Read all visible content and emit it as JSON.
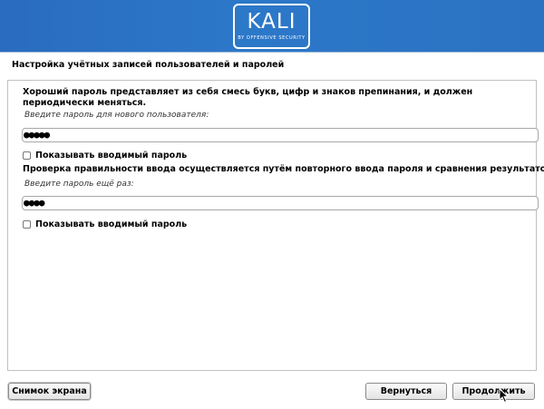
{
  "banner": {
    "logo_text": "KALI",
    "logo_subtitle": "BY OFFENSIVE SECURITY",
    "brand_color": "#2c75c6"
  },
  "page_title": "Настройка учётных записей пользователей и паролей",
  "section1": {
    "description": "Хороший пароль представляет из себя смесь букв, цифр и знаков препинания, и должен периодически меняться.",
    "prompt": "Введите пароль для нового пользователя:",
    "password_value": "●●●●●",
    "show_password_label": "Показывать вводимый пароль"
  },
  "section2": {
    "description": "Проверка правильности ввода осуществляется путём повторного ввода пароля и сравнения результатов.",
    "prompt": "Введите пароль ещё раз:",
    "password_value": "●●●●",
    "show_password_label": "Показывать вводимый пароль"
  },
  "buttons": {
    "screenshot": "Снимок экрана",
    "back": "Вернуться",
    "continue": "Продолжить"
  },
  "icons": {
    "checkbox": "checkbox-unchecked-icon",
    "cursor": "mouse-pointer-icon"
  }
}
